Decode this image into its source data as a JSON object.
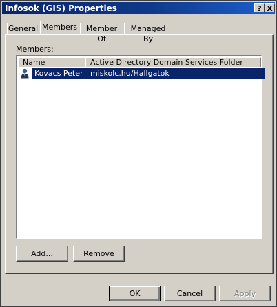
{
  "window": {
    "title": "Infosok (GIS) Properties",
    "help_glyph": "?",
    "close_glyph": "X"
  },
  "tabs": [
    {
      "label": "General",
      "active": false
    },
    {
      "label": "Members",
      "active": true
    },
    {
      "label": "Member Of",
      "active": false
    },
    {
      "label": "Managed By",
      "active": false
    }
  ],
  "members": {
    "label": "Members:",
    "columns": [
      "Name",
      "Active Directory Domain Services Folder"
    ],
    "rows": [
      {
        "name": "Kovacs Peter",
        "folder": "miskolc.hu/Hallgatok",
        "selected": true,
        "icon": "user-icon"
      }
    ]
  },
  "actions": {
    "add": "Add...",
    "remove": "Remove"
  },
  "footer": {
    "ok": "OK",
    "cancel": "Cancel",
    "apply": "Apply"
  },
  "colors": {
    "title_bar": "#0a246a",
    "selection": "#0a246a",
    "face": "#d4d0c8"
  }
}
